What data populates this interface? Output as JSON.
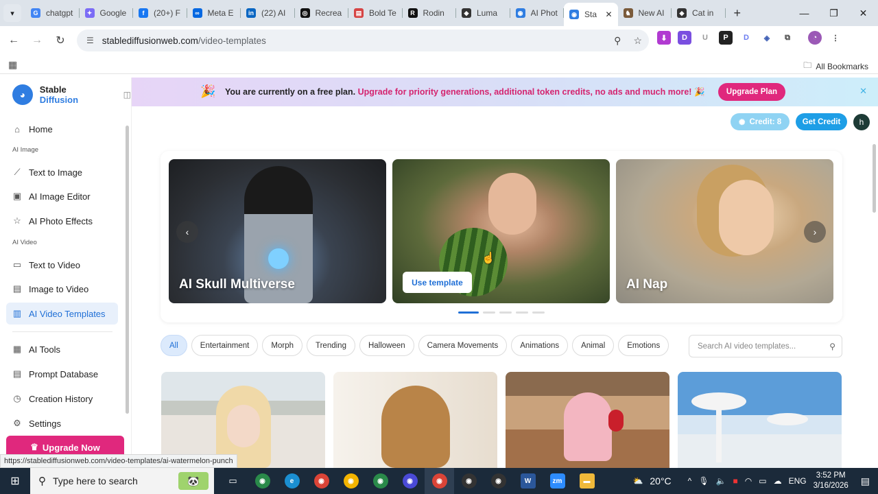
{
  "browser": {
    "tabs": [
      {
        "title": "chatgpt",
        "color": "#4285f4",
        "glyph": "G"
      },
      {
        "title": "Google",
        "color": "#7b6cf6",
        "glyph": "✦"
      },
      {
        "title": "(20+) F",
        "color": "#1877f2",
        "glyph": "f"
      },
      {
        "title": "Meta E",
        "color": "#0668e1",
        "glyph": "∞"
      },
      {
        "title": "(22) AI",
        "color": "#0a66c2",
        "glyph": "in"
      },
      {
        "title": "Recrea",
        "color": "#111111",
        "glyph": "◎"
      },
      {
        "title": "Bold Te",
        "color": "#d64545",
        "glyph": "▤"
      },
      {
        "title": "Rodin",
        "color": "#111111",
        "glyph": "R"
      },
      {
        "title": "Luma",
        "color": "#333333",
        "glyph": "◆"
      },
      {
        "title": "AI Phot",
        "color": "#2f7de1",
        "glyph": "◉"
      },
      {
        "title": "Sta",
        "color": "#2f7de1",
        "glyph": "◉",
        "active": true
      },
      {
        "title": "New AI",
        "color": "#7a5a3a",
        "glyph": "♞"
      },
      {
        "title": "Cat in",
        "color": "#333333",
        "glyph": "◆"
      }
    ],
    "url_domain": "stablediffusionweb.com",
    "url_path": "/video-templates",
    "bookmarks_label": "All Bookmarks",
    "status_url": "https://stablediffusionweb.com/video-templates/ai-watermelon-punch"
  },
  "sidebar": {
    "brand_first": "Stable",
    "brand_second": "Diffusion",
    "home": "Home",
    "section_image": "AI Image",
    "text_to_image": "Text to Image",
    "image_editor": "AI Image Editor",
    "photo_effects": "AI Photo Effects",
    "section_video": "AI Video",
    "text_to_video": "Text to Video",
    "image_to_video": "Image to Video",
    "video_templates": "AI Video Templates",
    "tools": "AI Tools",
    "prompt_db": "Prompt Database",
    "history": "Creation History",
    "settings": "Settings",
    "upgrade": "Upgrade Now"
  },
  "banner": {
    "plain": "You are currently on a free plan.",
    "highlight": "Upgrade for priority generations, additional token credits, no ads and much more!",
    "button": "Upgrade Plan"
  },
  "header": {
    "credit": "Credit: 8",
    "get_credit": "Get Credit",
    "avatar_letter": "h"
  },
  "carousel": {
    "cards": [
      {
        "caption": "AI Skull Multiverse"
      },
      {
        "caption": "",
        "action": "Use template"
      },
      {
        "caption": "AI Nap"
      }
    ],
    "active_dot": 0,
    "dot_count": 5
  },
  "filters": [
    "All",
    "Entertainment",
    "Morph",
    "Trending",
    "Halloween",
    "Camera Movements",
    "Animations",
    "Animal",
    "Emotions"
  ],
  "search": {
    "placeholder": "Search AI video templates..."
  },
  "taskbar": {
    "search_placeholder": "Type here to search",
    "temperature": "20°C",
    "language": "ENG",
    "time": "3:52 PM",
    "date": "3/16/2026"
  },
  "colors": {
    "accent": "#1f6fd6",
    "pink": "#e0287d",
    "sky": "#1e9ee6"
  }
}
